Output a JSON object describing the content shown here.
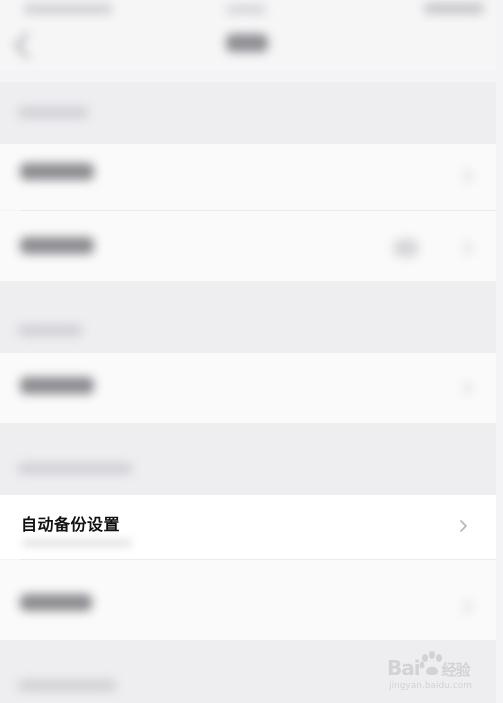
{
  "window": {
    "page_title_obscured": true
  },
  "settings": {
    "auto_backup_label": "自动备份设置"
  },
  "watermark": {
    "brand": "Bai",
    "brand_cn": "经验",
    "sub": "jingyan.baidu.com"
  },
  "icons": {
    "back": "chevron-left-icon",
    "row_chevron": "chevron-right-icon",
    "watermark_logo": "paw-icon"
  },
  "colors": {
    "background": "#f4f4f6",
    "row_background": "#ffffff",
    "text_primary": "#111111",
    "chevron": "#b8b8bd"
  }
}
